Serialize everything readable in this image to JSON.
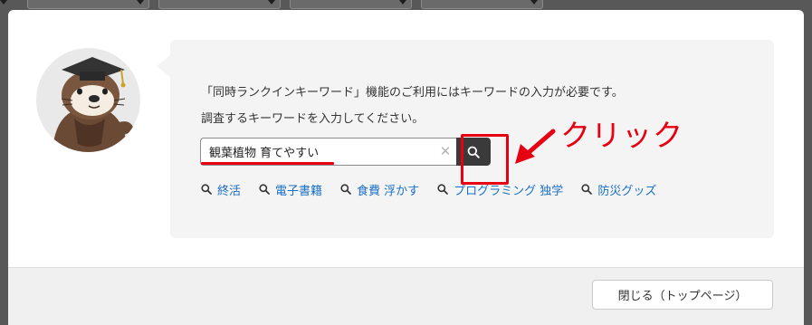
{
  "modal": {
    "message_line1": "「同時ランクインキーワード」機能のご利用にはキーワードの入力が必要です。",
    "message_line2": "調査するキーワードを入力してください。",
    "search": {
      "value": "観葉植物 育てやすい",
      "placeholder": ""
    },
    "suggestions": [
      "終活",
      "電子書籍",
      "食費 浮かす",
      "プログラミング 独学",
      "防災グッズ"
    ],
    "close_button_label": "閉じる（トップページ）"
  },
  "annotation": {
    "label": "クリック"
  },
  "colors": {
    "accent_red": "#e60012",
    "link_blue": "#1a6fc4",
    "search_button": "#3a3a3a",
    "panel_bg": "#f4f4f4"
  },
  "icons": {
    "search_button": "search-icon",
    "clear": "close-icon",
    "suggestion": "search-icon"
  }
}
